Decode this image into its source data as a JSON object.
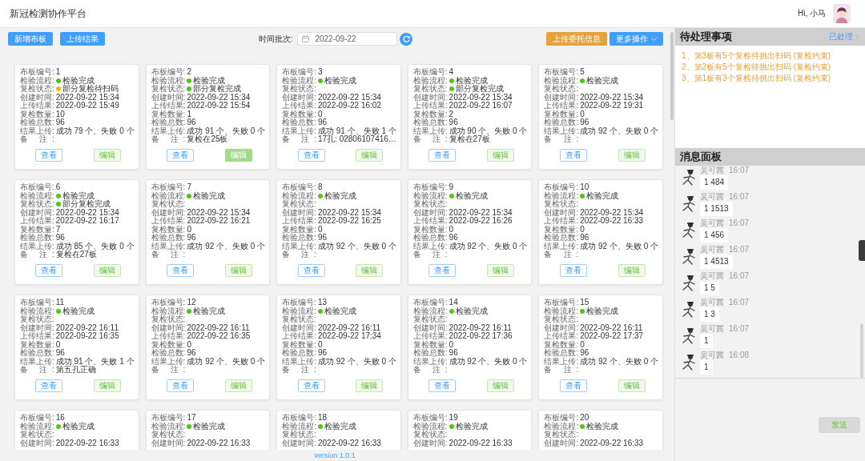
{
  "header": {
    "title": "新冠检测协作平台",
    "greeting": "Hi, 小马"
  },
  "toolbar": {
    "left_buttons": [
      {
        "label": "新增布板",
        "kind": "primary"
      },
      {
        "label": "上传结果",
        "kind": "primary"
      }
    ],
    "batch_label": "时间批次:",
    "date_value": "2022-09-22",
    "right_buttons": [
      {
        "label": "上传委托信息",
        "kind": "warning"
      },
      {
        "label": "更多操作",
        "kind": "dropdown"
      }
    ]
  },
  "cards": [
    {
      "fields": [
        {
          "label": "布板编号:",
          "value": "1"
        },
        {
          "label": "检验流程:",
          "value": "检验完成",
          "color": "#52c41a"
        },
        {
          "label": "复检状态:",
          "value": "部分复检待扫码",
          "color": "#f5b800"
        },
        {
          "label": "创建时间:",
          "value": "2022-09-22 15:34"
        },
        {
          "label": "上传结果:",
          "value": "2022-09-22 15:49"
        },
        {
          "label": "复检数量:",
          "value": "10"
        },
        {
          "label": "检验总数:",
          "value": "96"
        },
        {
          "label": "结果上传:",
          "value": "成功 79 个、失败 0 个"
        },
        {
          "label": "备 注:"
        }
      ],
      "buttons": [
        {
          "label": "查看",
          "kind": "view",
          "active": false
        },
        {
          "label": "编辑",
          "kind": "edit",
          "active": false
        }
      ]
    },
    {
      "fields": [
        {
          "label": "布板编号:",
          "value": "2"
        },
        {
          "label": "检验流程:",
          "value": "检验完成",
          "color": "#52c41a"
        },
        {
          "label": "复检状态:",
          "value": "部分复检完成",
          "color": "#52c41a"
        },
        {
          "label": "创建时间:",
          "value": "2022-09-22 15:34"
        },
        {
          "label": "上传结果:",
          "value": "2022-09-22 15:54"
        },
        {
          "label": "复检数量:",
          "value": "1"
        },
        {
          "label": "检验总数:",
          "value": "96"
        },
        {
          "label": "结果上传:",
          "value": "成功 91 个、失败 0 个"
        },
        {
          "label": "备 注:",
          "value": "复检在25板"
        }
      ],
      "buttons": [
        {
          "label": "查看",
          "kind": "view",
          "active": false
        },
        {
          "label": "编辑",
          "kind": "edit",
          "active": true
        }
      ]
    },
    {
      "fields": [
        {
          "label": "布板编号:",
          "value": "3"
        },
        {
          "label": "检验流程:",
          "value": "检验完成",
          "color": "#52c41a"
        },
        {
          "label": "复检状态:"
        },
        {
          "label": "创建时间:",
          "value": "2022-09-22 15:34"
        },
        {
          "label": "上传结果:",
          "value": "2022-09-22 16:02"
        },
        {
          "label": "复检数量:",
          "value": "0"
        },
        {
          "label": "检验总数:",
          "value": "96"
        },
        {
          "label": "结果上传:",
          "value": "成功 91 个、失败 1 个"
        },
        {
          "label": "备 注:",
          "value": "17孔: 02806107416…"
        }
      ],
      "buttons": [
        {
          "label": "查看",
          "kind": "view",
          "active": false
        },
        {
          "label": "编辑",
          "kind": "edit",
          "active": false
        }
      ]
    },
    {
      "fields": [
        {
          "label": "布板编号:",
          "value": "4"
        },
        {
          "label": "检验流程:",
          "value": "检验完成",
          "color": "#52c41a"
        },
        {
          "label": "复检状态:",
          "value": "部分复检完成",
          "color": "#52c41a"
        },
        {
          "label": "创建时间:",
          "value": "2022-09-22 15:34"
        },
        {
          "label": "上传结果:",
          "value": "2022-09-22 16:07"
        },
        {
          "label": "复检数量:",
          "value": "2"
        },
        {
          "label": "检验总数:",
          "value": "96"
        },
        {
          "label": "结果上传:",
          "value": "成功 90 个、失败 0 个"
        },
        {
          "label": "备 注:",
          "value": "复检在27板"
        }
      ],
      "buttons": [
        {
          "label": "查看",
          "kind": "view",
          "active": false
        },
        {
          "label": "编辑",
          "kind": "edit",
          "active": false
        }
      ]
    },
    {
      "fields": [
        {
          "label": "布板编号:",
          "value": "5"
        },
        {
          "label": "检验流程:",
          "value": "检验完成",
          "color": "#52c41a"
        },
        {
          "label": "复检状态:"
        },
        {
          "label": "创建时间:",
          "value": "2022-09-22 15:34"
        },
        {
          "label": "上传结果:",
          "value": "2022-09-22 19:31"
        },
        {
          "label": "复检数量:",
          "value": "0"
        },
        {
          "label": "检验总数:",
          "value": "96"
        },
        {
          "label": "结果上传:",
          "value": "成功 92 个、失败 0 个"
        },
        {
          "label": "备 注:"
        }
      ],
      "buttons": [
        {
          "label": "查看",
          "kind": "view",
          "active": false
        },
        {
          "label": "编辑",
          "kind": "edit",
          "active": false
        }
      ]
    },
    {
      "fields": [
        {
          "label": "布板编号:",
          "value": "6"
        },
        {
          "label": "检验流程:",
          "value": "检验完成",
          "color": "#52c41a"
        },
        {
          "label": "复检状态:",
          "value": "部分复检完成",
          "color": "#52c41a"
        },
        {
          "label": "创建时间:",
          "value": "2022-09-22 15:34"
        },
        {
          "label": "上传结果:",
          "value": "2022-09-22 16:17"
        },
        {
          "label": "复检数量:",
          "value": "7"
        },
        {
          "label": "检验总数:",
          "value": "96"
        },
        {
          "label": "结果上传:",
          "value": "成功 85 个、失败 0 个"
        },
        {
          "label": "备 注:",
          "value": "复检在27板"
        }
      ],
      "buttons": [
        {
          "label": "查看",
          "kind": "view",
          "active": false
        },
        {
          "label": "编辑",
          "kind": "edit",
          "active": false
        }
      ]
    },
    {
      "fields": [
        {
          "label": "布板编号:",
          "value": "7"
        },
        {
          "label": "检验流程:",
          "value": "检验完成",
          "color": "#52c41a"
        },
        {
          "label": "复检状态:"
        },
        {
          "label": "创建时间:",
          "value": "2022-09-22 15:34"
        },
        {
          "label": "上传结果:",
          "value": "2022-09-22 16:21"
        },
        {
          "label": "复检数量:",
          "value": "0"
        },
        {
          "label": "检验总数:",
          "value": "96"
        },
        {
          "label": "结果上传:",
          "value": "成功 92 个、失败 0 个"
        },
        {
          "label": "备 注:"
        }
      ],
      "buttons": [
        {
          "label": "查看",
          "kind": "view",
          "active": false
        },
        {
          "label": "编辑",
          "kind": "edit",
          "active": false
        }
      ]
    },
    {
      "fields": [
        {
          "label": "布板编号:",
          "value": "8"
        },
        {
          "label": "检验流程:",
          "value": "检验完成",
          "color": "#52c41a"
        },
        {
          "label": "复检状态:"
        },
        {
          "label": "创建时间:",
          "value": "2022-09-22 15:34"
        },
        {
          "label": "上传结果:",
          "value": "2022-09-22 16:25"
        },
        {
          "label": "复检数量:",
          "value": "0"
        },
        {
          "label": "检验总数:",
          "value": "96"
        },
        {
          "label": "结果上传:",
          "value": "成功 92 个、失败 0 个"
        },
        {
          "label": "备 注:"
        }
      ],
      "buttons": [
        {
          "label": "查看",
          "kind": "view",
          "active": false
        },
        {
          "label": "编辑",
          "kind": "edit",
          "active": false
        }
      ]
    },
    {
      "fields": [
        {
          "label": "布板编号:",
          "value": "9"
        },
        {
          "label": "检验流程:",
          "value": "检验完成",
          "color": "#52c41a"
        },
        {
          "label": "复检状态:"
        },
        {
          "label": "创建时间:",
          "value": "2022-09-22 15:34"
        },
        {
          "label": "上传结果:",
          "value": "2022-09-22 16:26"
        },
        {
          "label": "复检数量:",
          "value": "0"
        },
        {
          "label": "检验总数:",
          "value": "96"
        },
        {
          "label": "结果上传:",
          "value": "成功 92 个、失败 0 个"
        },
        {
          "label": "备 注:"
        }
      ],
      "buttons": [
        {
          "label": "查看",
          "kind": "view",
          "active": false
        },
        {
          "label": "编辑",
          "kind": "edit",
          "active": false
        }
      ]
    },
    {
      "fields": [
        {
          "label": "布板编号:",
          "value": "10"
        },
        {
          "label": "检验流程:",
          "value": "检验完成",
          "color": "#52c41a"
        },
        {
          "label": "复检状态:"
        },
        {
          "label": "创建时间:",
          "value": "2022-09-22 15:34"
        },
        {
          "label": "上传结果:",
          "value": "2022-09-22 16:33"
        },
        {
          "label": "复检数量:",
          "value": "0"
        },
        {
          "label": "检验总数:",
          "value": "96"
        },
        {
          "label": "结果上传:",
          "value": "成功 92 个、失败 0 个"
        },
        {
          "label": "备 注:"
        }
      ],
      "buttons": [
        {
          "label": "查看",
          "kind": "view",
          "active": false
        },
        {
          "label": "编辑",
          "kind": "edit",
          "active": false
        }
      ]
    },
    {
      "fields": [
        {
          "label": "布板编号:",
          "value": "11"
        },
        {
          "label": "检验流程:",
          "value": "检验完成",
          "color": "#52c41a"
        },
        {
          "label": "复检状态:"
        },
        {
          "label": "创建时间:",
          "value": "2022-09-22 16:11"
        },
        {
          "label": "上传结果:",
          "value": "2022-09-22 16:35"
        },
        {
          "label": "复检数量:",
          "value": "0"
        },
        {
          "label": "检验总数:",
          "value": "96"
        },
        {
          "label": "结果上传:",
          "value": "成功 91 个、失败 1 个"
        },
        {
          "label": "备 注:",
          "value": "第五孔正确"
        }
      ],
      "buttons": [
        {
          "label": "查看",
          "kind": "view",
          "active": false
        },
        {
          "label": "编辑",
          "kind": "edit",
          "active": false
        }
      ]
    },
    {
      "fields": [
        {
          "label": "布板编号:",
          "value": "12"
        },
        {
          "label": "检验流程:",
          "value": "检验完成",
          "color": "#52c41a"
        },
        {
          "label": "复检状态:"
        },
        {
          "label": "创建时间:",
          "value": "2022-09-22 16:11"
        },
        {
          "label": "上传结果:",
          "value": "2022-09-22 16:35"
        },
        {
          "label": "复检数量:",
          "value": "0"
        },
        {
          "label": "检验总数:",
          "value": "96"
        },
        {
          "label": "结果上传:",
          "value": "成功 92 个、失败 0 个"
        },
        {
          "label": "备 注:"
        }
      ],
      "buttons": [
        {
          "label": "查看",
          "kind": "view",
          "active": false
        },
        {
          "label": "编辑",
          "kind": "edit",
          "active": false
        }
      ]
    },
    {
      "fields": [
        {
          "label": "布板编号:",
          "value": "13"
        },
        {
          "label": "检验流程:",
          "value": "检验完成",
          "color": "#52c41a"
        },
        {
          "label": "复检状态:"
        },
        {
          "label": "创建时间:",
          "value": "2022-09-22 16:11"
        },
        {
          "label": "上传结果:",
          "value": "2022-09-22 17:34"
        },
        {
          "label": "复检数量:",
          "value": "0"
        },
        {
          "label": "检验总数:",
          "value": "96"
        },
        {
          "label": "结果上传:",
          "value": "成功 92 个、失败 0 个"
        },
        {
          "label": "备 注:"
        }
      ],
      "buttons": [
        {
          "label": "查看",
          "kind": "view",
          "active": false
        },
        {
          "label": "编辑",
          "kind": "edit",
          "active": false
        }
      ]
    },
    {
      "fields": [
        {
          "label": "布板编号:",
          "value": "14"
        },
        {
          "label": "检验流程:",
          "value": "检验完成",
          "color": "#52c41a"
        },
        {
          "label": "复检状态:"
        },
        {
          "label": "创建时间:",
          "value": "2022-09-22 16:11"
        },
        {
          "label": "上传结果:",
          "value": "2022-09-22 17:36"
        },
        {
          "label": "复检数量:",
          "value": "0"
        },
        {
          "label": "检验总数:",
          "value": "96"
        },
        {
          "label": "结果上传:",
          "value": "成功 92 个、失败 0 个"
        },
        {
          "label": "备 注:"
        }
      ],
      "buttons": [
        {
          "label": "查看",
          "kind": "view",
          "active": false
        },
        {
          "label": "编辑",
          "kind": "edit",
          "active": false
        }
      ]
    },
    {
      "fields": [
        {
          "label": "布板编号:",
          "value": "15"
        },
        {
          "label": "检验流程:",
          "value": "检验完成",
          "color": "#52c41a"
        },
        {
          "label": "复检状态:"
        },
        {
          "label": "创建时间:",
          "value": "2022-09-22 16:11"
        },
        {
          "label": "上传结果:",
          "value": "2022-09-22 17:37"
        },
        {
          "label": "复检数量:",
          "value": "0"
        },
        {
          "label": "检验总数:",
          "value": "96"
        },
        {
          "label": "结果上传:",
          "value": "成功 92 个、失败 0 个"
        },
        {
          "label": "备 注:"
        }
      ],
      "buttons": [
        {
          "label": "查看",
          "kind": "view",
          "active": false
        },
        {
          "label": "编辑",
          "kind": "edit",
          "active": false
        }
      ]
    },
    {
      "fields": [
        {
          "label": "布板编号:",
          "value": "16"
        },
        {
          "label": "检验流程:",
          "value": "检验完成",
          "color": "#52c41a"
        },
        {
          "label": "复检状态:"
        },
        {
          "label": "创建时间:",
          "value": "2022-09-22 16:33"
        }
      ]
    },
    {
      "fields": [
        {
          "label": "布板编号:",
          "value": "17"
        },
        {
          "label": "检验流程:",
          "value": "检验完成",
          "color": "#52c41a"
        },
        {
          "label": "复检状态:"
        },
        {
          "label": "创建时间:",
          "value": "2022-09-22 16:33"
        }
      ]
    },
    {
      "fields": [
        {
          "label": "布板编号:",
          "value": "18"
        },
        {
          "label": "检验流程:",
          "value": "检验完成",
          "color": "#52c41a"
        },
        {
          "label": "复检状态:"
        },
        {
          "label": "创建时间:",
          "value": "2022-09-22 16:33"
        }
      ]
    },
    {
      "fields": [
        {
          "label": "布板编号:",
          "value": "19"
        },
        {
          "label": "检验流程:",
          "value": "检验完成",
          "color": "#52c41a"
        },
        {
          "label": "复检状态:"
        },
        {
          "label": "创建时间:",
          "value": "2022-09-22 16:33"
        }
      ]
    },
    {
      "fields": [
        {
          "label": "布板编号:",
          "value": "20"
        },
        {
          "label": "检验流程:",
          "value": "检验完成",
          "color": "#52c41a"
        },
        {
          "label": "复检状态:"
        },
        {
          "label": "创建时间:",
          "value": "2022-09-22 16:33"
        }
      ]
    }
  ],
  "footer": {
    "version": "version 1.0.1"
  },
  "pending": {
    "title": "待处理事项",
    "link": "已处理",
    "items": [
      "1、第3板有5个复检待挑出扫码 (复检约束)",
      "2、第2板有5个复检待挑出扫码 (复检约束)",
      "3、第1板有3个复检待挑出扫码 (复检约束)"
    ]
  },
  "messages": {
    "title": "消息面板",
    "items": [
      {
        "sender": "吴可茜",
        "time": "16:07",
        "text": "1 484"
      },
      {
        "sender": "吴可茜",
        "time": "16:07",
        "text": "1 1513"
      },
      {
        "sender": "吴可茜",
        "time": "16:07",
        "text": "1 456"
      },
      {
        "sender": "吴可茜",
        "time": "16:07",
        "text": "1 4513"
      },
      {
        "sender": "吴可茜",
        "time": "16:07",
        "text": "1 5"
      },
      {
        "sender": "吴可茜",
        "time": "16:07",
        "text": "1 3"
      },
      {
        "sender": "吴可茜",
        "time": "16:07",
        "text": "1"
      },
      {
        "sender": "吴可茜",
        "time": "16:08",
        "text": "1"
      }
    ],
    "send_button": "发送"
  }
}
